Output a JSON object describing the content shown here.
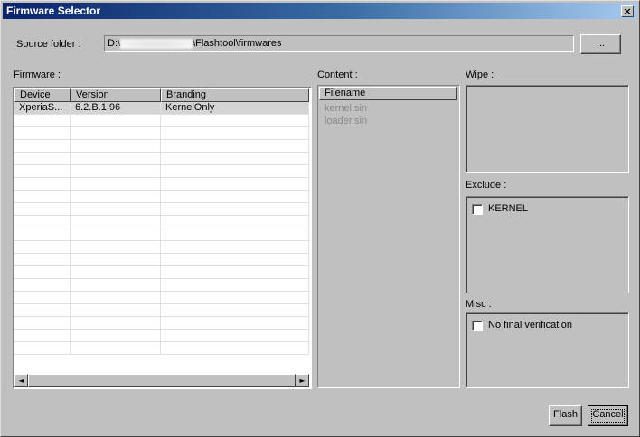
{
  "window": {
    "title": "Firmware Selector",
    "close_symbol": "×"
  },
  "source": {
    "label": "Source folder :",
    "path_prefix": "D:\\",
    "path_suffix": "\\Flashtool\\firmwares",
    "browse_label": "..."
  },
  "firmware": {
    "label": "Firmware :",
    "columns": [
      "Device",
      "Version",
      "Branding"
    ],
    "rows": [
      {
        "device": "XperiaS...",
        "version": "6.2.B.1.96",
        "branding": "KernelOnly"
      }
    ],
    "scroll_left": "◄",
    "scroll_right": "►"
  },
  "content": {
    "label": "Content :",
    "header": "Filename",
    "items": [
      "kernel.sin",
      "loader.sin"
    ]
  },
  "wipe": {
    "label": "Wipe :"
  },
  "exclude": {
    "label": "Exclude :",
    "options": [
      {
        "label": "KERNEL",
        "checked": false
      }
    ]
  },
  "misc": {
    "label": "Misc :",
    "options": [
      {
        "label": "No final verification",
        "checked": false
      }
    ]
  },
  "buttons": {
    "flash": "Flash",
    "cancel": "Cancel"
  }
}
